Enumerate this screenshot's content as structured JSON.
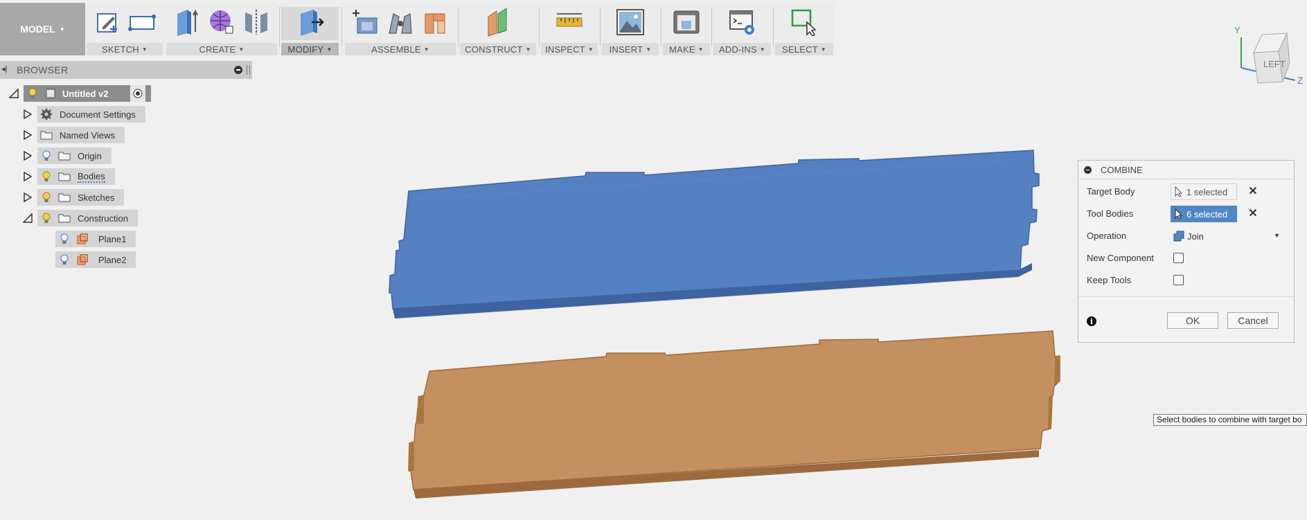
{
  "workspace": {
    "label": "MODEL"
  },
  "toolbar": {
    "groups": [
      {
        "label": "SKETCH"
      },
      {
        "label": "CREATE"
      },
      {
        "label": "MODIFY"
      },
      {
        "label": "ASSEMBLE"
      },
      {
        "label": "CONSTRUCT"
      },
      {
        "label": "INSPECT"
      },
      {
        "label": "INSERT"
      },
      {
        "label": "MAKE"
      },
      {
        "label": "ADD-INS"
      },
      {
        "label": "SELECT"
      }
    ]
  },
  "browser": {
    "title": "BROWSER",
    "root": {
      "label": "Untitled v2"
    },
    "items": [
      {
        "label": "Document Settings"
      },
      {
        "label": "Named Views"
      },
      {
        "label": "Origin"
      },
      {
        "label": "Bodies"
      },
      {
        "label": "Sketches"
      },
      {
        "label": "Construction"
      },
      {
        "label": "Plane1"
      },
      {
        "label": "Plane2"
      }
    ]
  },
  "viewcube": {
    "face": "LEFT",
    "axis_y": "Y",
    "axis_z": "Z"
  },
  "combine": {
    "title": "COMBINE",
    "target_body": {
      "label": "Target Body",
      "value": "1 selected"
    },
    "tool_bodies": {
      "label": "Tool Bodies",
      "value": "6 selected"
    },
    "operation": {
      "label": "Operation",
      "value": "Join"
    },
    "new_component": {
      "label": "New Component"
    },
    "keep_tools": {
      "label": "Keep Tools"
    },
    "ok": "OK",
    "cancel": "Cancel"
  },
  "tooltip": {
    "text": "Select bodies to combine with target bo"
  },
  "colors": {
    "blue_body": "#5580c2",
    "tan_body": "#c4905f",
    "accent": "#4f86c6"
  }
}
